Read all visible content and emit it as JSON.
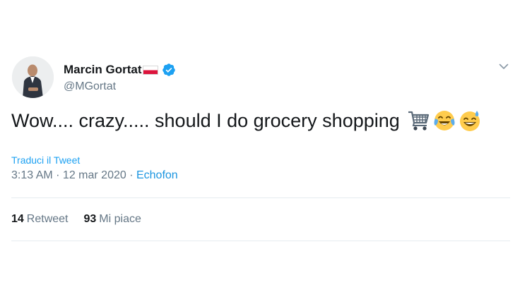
{
  "author": {
    "display_name": "Marcin Gortat",
    "handle": "@MGortat",
    "flag_icon": "poland-flag-icon",
    "verified_icon": "verified-badge-icon",
    "verified_color": "#1da1f2"
  },
  "tweet": {
    "text": "Wow.... crazy..... should I do grocery shopping",
    "emojis": [
      "shopping-cart-emoji",
      "tears-of-joy-emoji",
      "grinning-sweat-emoji"
    ],
    "translate_link": "Traduci il Tweet",
    "time": "3:13 AM",
    "separator1": " · ",
    "date": "12 mar 2020",
    "separator2": " · ",
    "source": "Echofon"
  },
  "stats": {
    "retweets_count": "14",
    "retweets_label": "Retweet",
    "likes_count": "93",
    "likes_label": "Mi piace"
  },
  "colors": {
    "text": "#14171a",
    "secondary": "#657786",
    "link": "#1da1f2",
    "divider": "#e6ecf0"
  }
}
